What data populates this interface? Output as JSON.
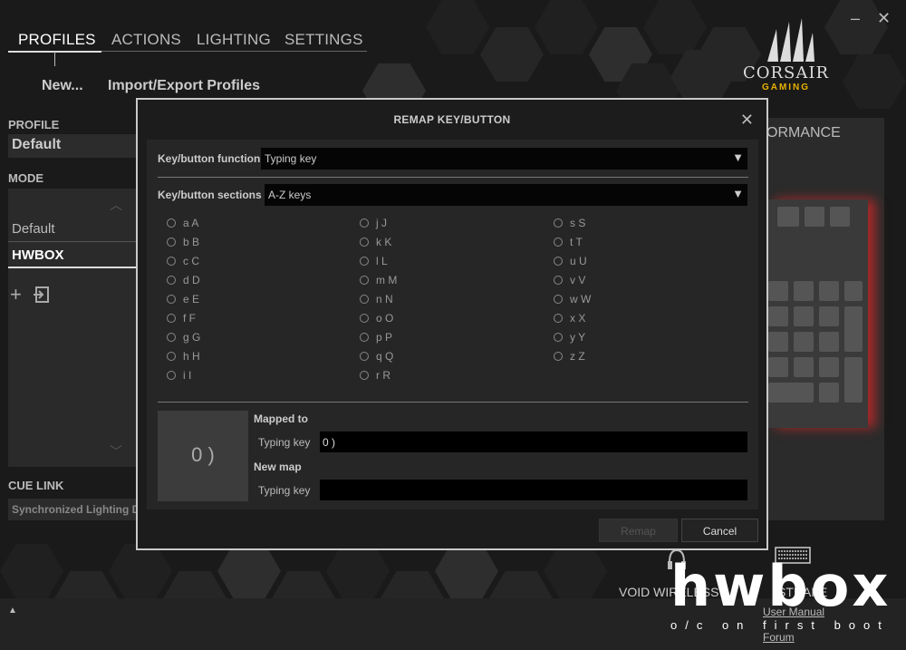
{
  "nav": {
    "tabs": [
      "PROFILES",
      "ACTIONS",
      "LIGHTING",
      "SETTINGS"
    ],
    "active_tab": "PROFILES",
    "minimize": "–",
    "close": "✕"
  },
  "subnav": {
    "new_label": "New...",
    "import_export_label": "Import/Export Profiles"
  },
  "logo": {
    "brand": "CORSAIR",
    "sub": "GAMING"
  },
  "sidebar": {
    "profile_label": "PROFILE",
    "profile_value": "Default",
    "mode_label": "MODE",
    "modes": [
      "Default",
      "HWBOX"
    ],
    "selected_mode": "HWBOX",
    "cue_link_label": "CUE LINK",
    "cue_link_value": "Synchronized Lighting D"
  },
  "background_panel": {
    "title_fragment": "ORMANCE"
  },
  "devices": [
    "VOID WIRELESS",
    "STRAFE"
  ],
  "footer_links": [
    "User Manual",
    "Forum"
  ],
  "watermark": {
    "big": "hwbox",
    "tag": "o/c on first boot"
  },
  "modal": {
    "title": "REMAP KEY/BUTTON",
    "function_label": "Key/button function",
    "function_value": "Typing key",
    "sections_label": "Key/button sections",
    "sections_value": "A-Z keys",
    "keys_col1": [
      "a A",
      "b B",
      "c C",
      "d D",
      "e E",
      "f F",
      "g G",
      "h H",
      "i I"
    ],
    "keys_col2": [
      "j J",
      "k K",
      "l L",
      "m M",
      "n N",
      "o O",
      "p P",
      "q Q",
      "r R"
    ],
    "keys_col3": [
      "s S",
      "t T",
      "u U",
      "v V",
      "w W",
      "x X",
      "y Y",
      "z Z"
    ],
    "preview_key": "0 )",
    "mapped_to_label": "Mapped to",
    "mapped_type_label": "Typing key",
    "mapped_value": "0 )",
    "new_map_label": "New map",
    "new_map_type_label": "Typing key",
    "new_map_value": "",
    "remap_button": "Remap",
    "cancel_button": "Cancel"
  }
}
